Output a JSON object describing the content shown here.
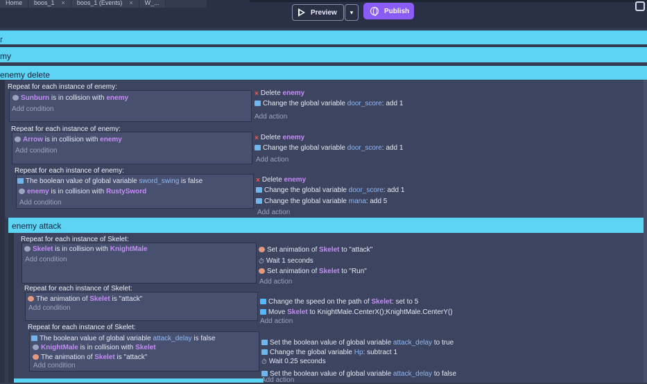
{
  "tabs": [
    {
      "label": "Home"
    },
    {
      "label": "boos_1",
      "close": "×"
    },
    {
      "label": "boos_1 (Events)",
      "close": "×"
    },
    {
      "label": "W_..."
    }
  ],
  "toolbar": {
    "preview_label": "Preview",
    "dropdown_arrow": "▾",
    "publish_label": "Publish"
  },
  "groups": {
    "g1": "r",
    "g2": "my",
    "enemy_delete": "enemy delete",
    "enemy_attack": "enemy attack"
  },
  "events": [
    {
      "header": "Repeat for each instance of enemy:",
      "conditions": [
        {
          "subject": "Sunburn",
          "text": " is in collision with ",
          "object": "enemy"
        }
      ],
      "add_condition": "Add condition",
      "actions": [
        {
          "type": "delete",
          "text": "Delete ",
          "object": "enemy"
        },
        {
          "type": "global",
          "text": "Change the global variable ",
          "var": "door_score",
          "tail": ": add 1"
        }
      ],
      "add_action": "Add action"
    },
    {
      "header": "Repeat for each instance of enemy:",
      "conditions": [
        {
          "subject": "Arrow",
          "text": " is in collision with ",
          "object": "enemy"
        }
      ],
      "add_condition": "Add condition",
      "actions": [
        {
          "type": "delete",
          "text": "Delete ",
          "object": "enemy"
        },
        {
          "type": "global",
          "text": "Change the global variable ",
          "var": "door_score",
          "tail": ": add 1"
        }
      ],
      "add_action": "Add action"
    },
    {
      "header": "Repeat for each instance of enemy:",
      "conditions": [
        {
          "prefix": "The boolean value of global variable ",
          "var": "sword_swing",
          "tail": " is false"
        },
        {
          "subject": "enemy",
          "text": " is in collision with ",
          "object": "RustySword"
        }
      ],
      "add_condition": "Add condition",
      "actions": [
        {
          "type": "delete",
          "text": "Delete ",
          "object": "enemy"
        },
        {
          "type": "global",
          "text": "Change the global variable ",
          "var": "door_score",
          "tail": ": add 1"
        },
        {
          "type": "global",
          "text": "Change the global variable ",
          "var": "mana",
          "tail": ": add 5"
        }
      ],
      "add_action": "Add action"
    },
    {
      "header": "Repeat for each instance of Skelet:",
      "conditions": [
        {
          "subject": "Skelet",
          "text": " is in collision with ",
          "object": "KnightMale"
        }
      ],
      "add_condition": "Add condition",
      "actions": [
        {
          "type": "anim",
          "text": "Set animation of ",
          "object": "Skelet",
          "tail": " to \"attack\""
        },
        {
          "type": "wait",
          "text": "Wait 1 seconds"
        },
        {
          "type": "anim",
          "text": "Set animation of ",
          "object": "Skelet",
          "tail": " to \"Run\""
        }
      ],
      "add_action": "Add action"
    },
    {
      "header": "Repeat for each instance of Skelet:",
      "conditions": [
        {
          "prefix": "The animation of ",
          "object": "Skelet",
          "tail": " is \"attack\""
        }
      ],
      "add_condition": "Add condition",
      "actions": [
        {
          "type": "path",
          "text": "Change the speed on the path of ",
          "object": "Skelet",
          "tail": ": set to 5"
        },
        {
          "type": "path",
          "text": "Move ",
          "object": "Skelet",
          "tail": " to KnightMale.CenterX();KnightMale.CenterY()"
        }
      ],
      "add_action": "Add action"
    },
    {
      "header": "Repeat for each instance of Skelet:",
      "conditions": [
        {
          "prefix": "The boolean value of global variable ",
          "var": "attack_delay",
          "tail": " is false"
        },
        {
          "subject": "KnightMale",
          "text": " is in collision with ",
          "object": "Skelet"
        },
        {
          "prefix": "The animation of ",
          "object": "Skelet",
          "tail": " is \"attack\""
        }
      ],
      "add_condition": "Add condition",
      "actions": [
        {
          "type": "global",
          "text": "Set the boolean value of global variable ",
          "var": "attack_delay",
          "tail": " to true"
        },
        {
          "type": "global",
          "text": "Change the global variable ",
          "var": "Hp",
          "tail": ": subtract 1"
        },
        {
          "type": "wait",
          "text": "Wait 0.25 seconds"
        },
        {
          "type": "global",
          "text": "Set the boolean value of global variable ",
          "var": "attack_delay",
          "tail": " to false"
        }
      ],
      "add_action": "Add action"
    }
  ],
  "icons": {
    "delete": "×",
    "wait": "⏱"
  },
  "colors": {
    "group_band": "#5ed4f4",
    "publish": "#8a5cf5",
    "object": "#c48df5",
    "variable": "#8fb9f5",
    "delete": "#ff5a4b"
  }
}
